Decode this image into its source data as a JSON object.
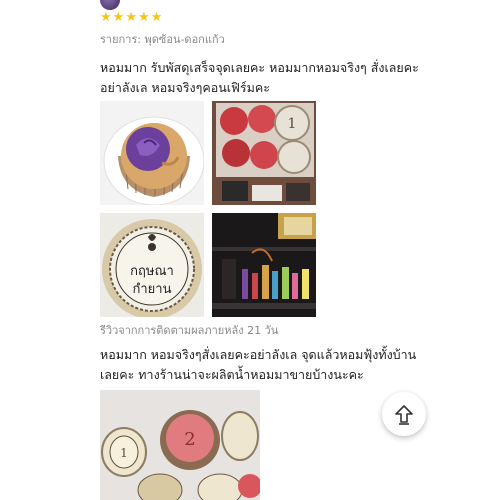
{
  "review": {
    "rating": 5,
    "variant_label": "รายการ: พุดซ้อน-ดอกแก้ว",
    "text": "หอมมาก  รับพัสดุเสร็จจุดเลยคะ  หอมมากหอมจริงๆ สั่งเลยคะอย่าลังเล หอมจริงๆคอนเฟิร์มคะ",
    "photos": [
      {
        "name": "photo-purple-rose-soap",
        "description_icon": "soap-icon"
      },
      {
        "name": "photo-red-soaps-box",
        "description_icon": "soap-icon"
      },
      {
        "name": "photo-label-soap",
        "label": "กฤษณา กำยาน"
      },
      {
        "name": "photo-shelf-bottles",
        "description_icon": "bottle-icon"
      }
    ]
  },
  "followup": {
    "header": "รีวิวจากการติดตามผลภายหลัง 21 วัน",
    "text": "หอมมาก หอมจริงๆสั่งเลยคะอย่าลังเล จุดแล้วหอมฟุ้งทั้งบ้านเลยคะ ทางร้านน่าจะผลิตน้ำหอมมาขายบ้างนะคะ"
  },
  "scroll_top_icon": "arrow-up-icon",
  "colors": {
    "star": "#f5c518",
    "muted": "#8a8a8a",
    "text": "#1f1f1f"
  }
}
